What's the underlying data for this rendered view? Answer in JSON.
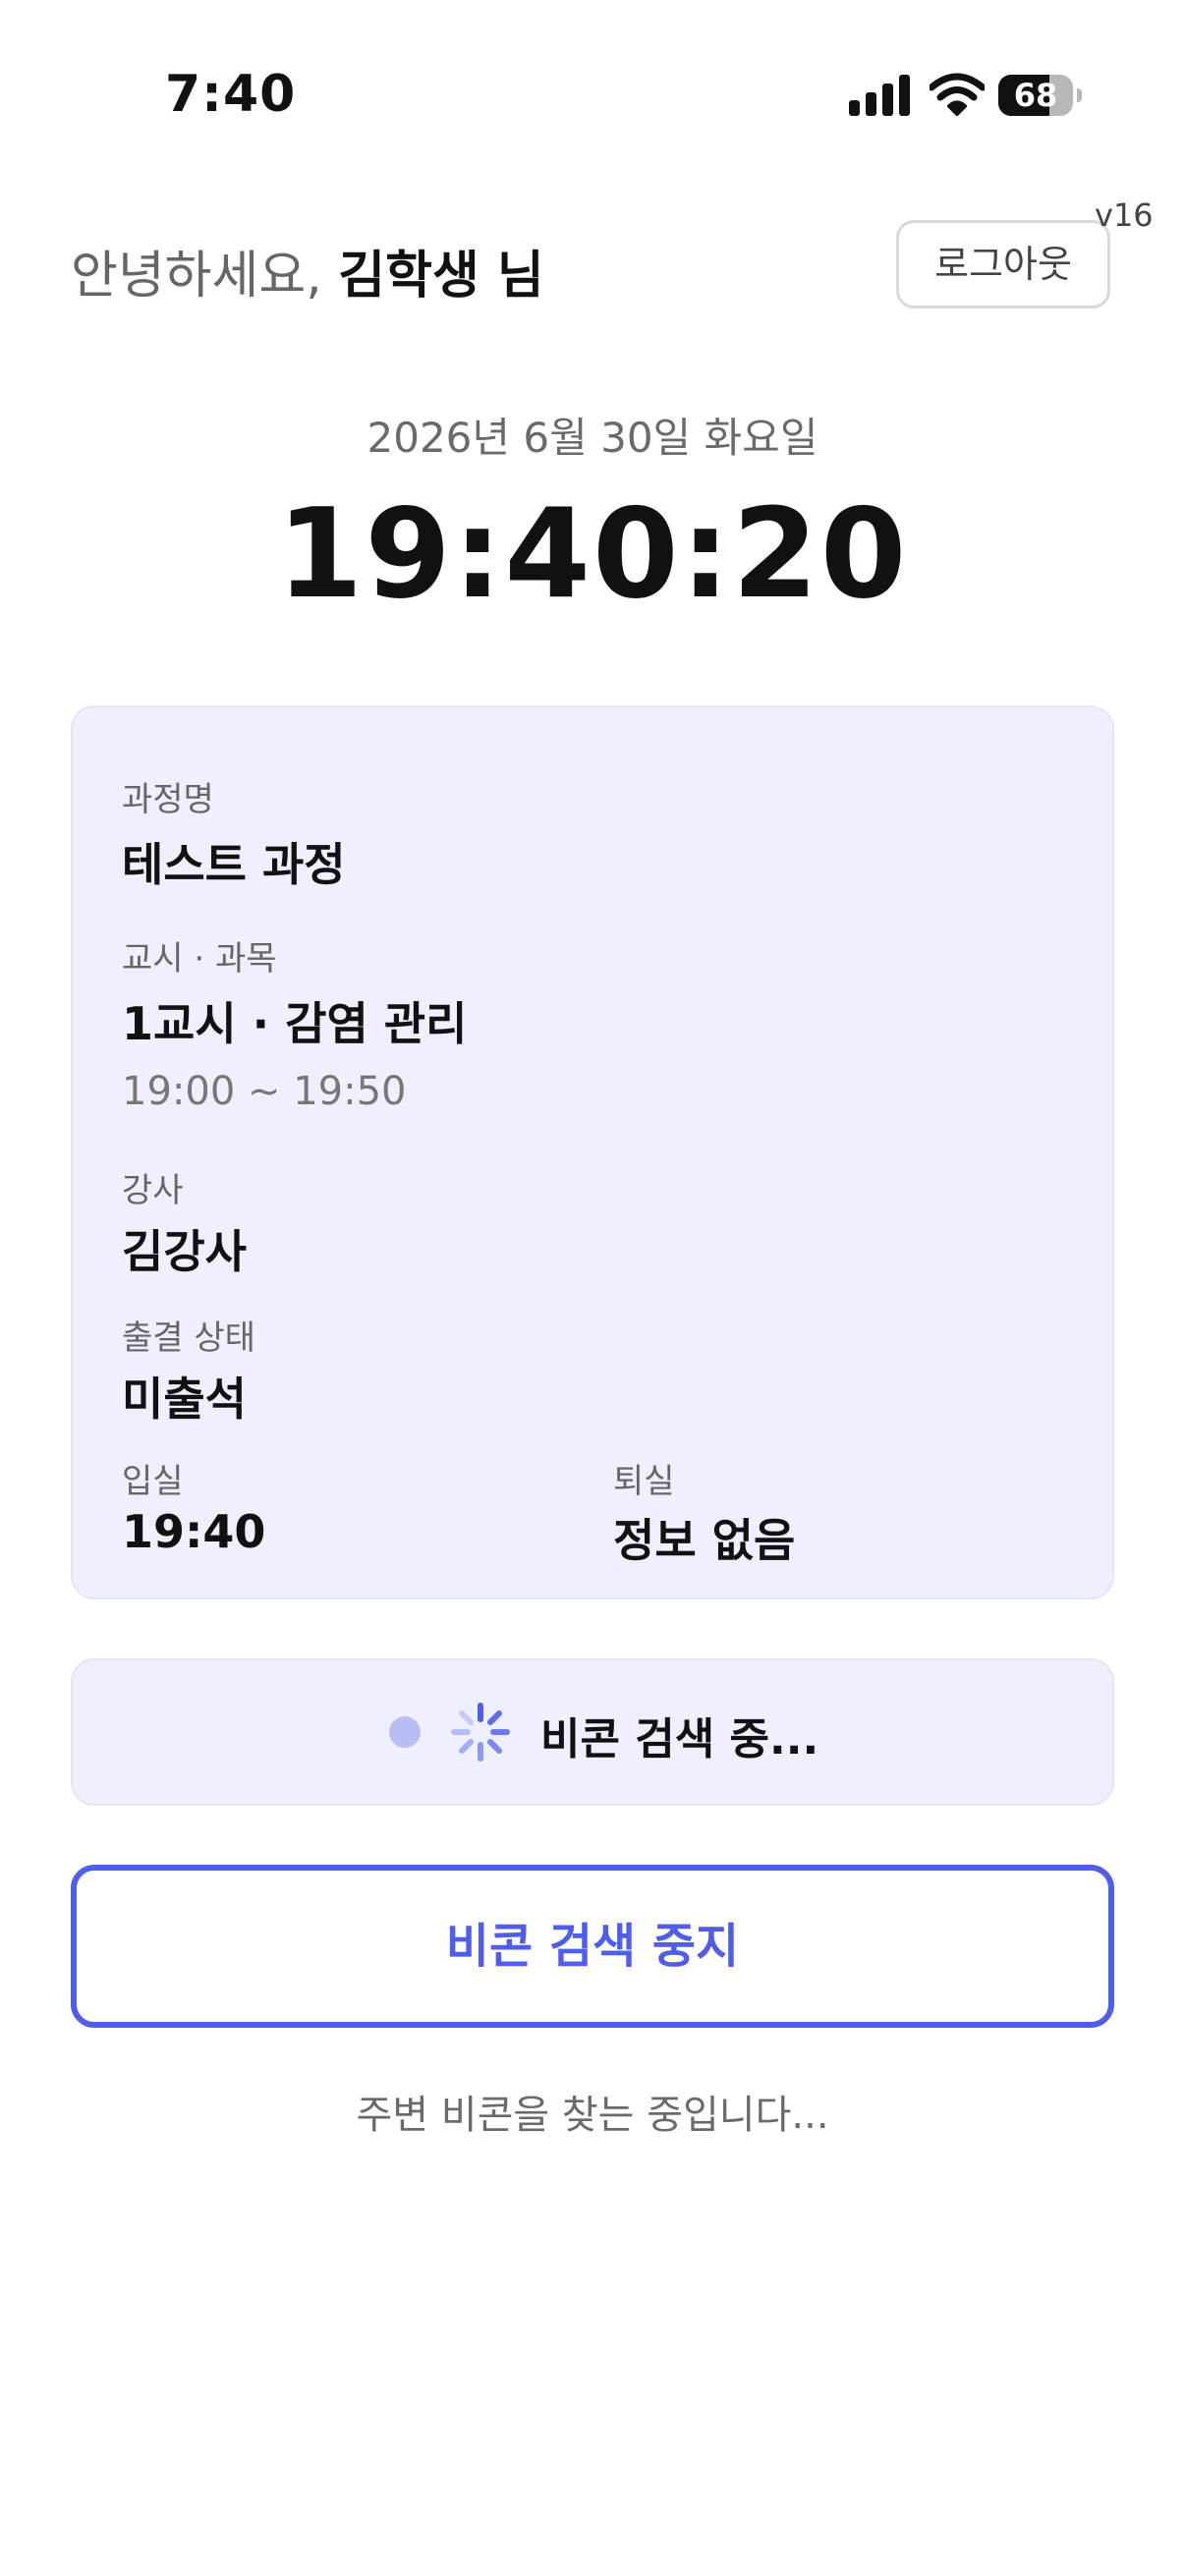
{
  "status_bar": {
    "time": "7:40",
    "battery_level": "68",
    "battery_percent": 68,
    "icons": [
      "signal-icon",
      "wifi-icon",
      "battery-icon"
    ]
  },
  "header": {
    "greeting_prefix": "안녕하세요, ",
    "user_name": "김학생 님",
    "logout_label": "로그아웃",
    "version": "v16"
  },
  "clock": {
    "date": "2026년 6월 30일 화요일",
    "time": "19:40:20"
  },
  "info": {
    "course_label": "과정명",
    "course_value": "테스트 과정",
    "period_label": "교시 · 과목",
    "period_value": "1교시 · 감염 관리",
    "period_time": "19:00 ~ 19:50",
    "instructor_label": "강사",
    "instructor_value": "김강사",
    "attendance_label": "출결 상태",
    "attendance_value": "미출석",
    "checkin_label": "입실",
    "checkin_value": "19:40",
    "checkout_label": "퇴실",
    "checkout_value": "정보 없음"
  },
  "beacon": {
    "status_text": "비콘 검색 중...",
    "stop_label": "비콘 검색 중지",
    "helper_text": "주변 비콘을 찾는 중입니다..."
  },
  "colors": {
    "accent": "#4f5de8",
    "card_bg": "#eef0ff",
    "dot": "#b9bdf5"
  }
}
